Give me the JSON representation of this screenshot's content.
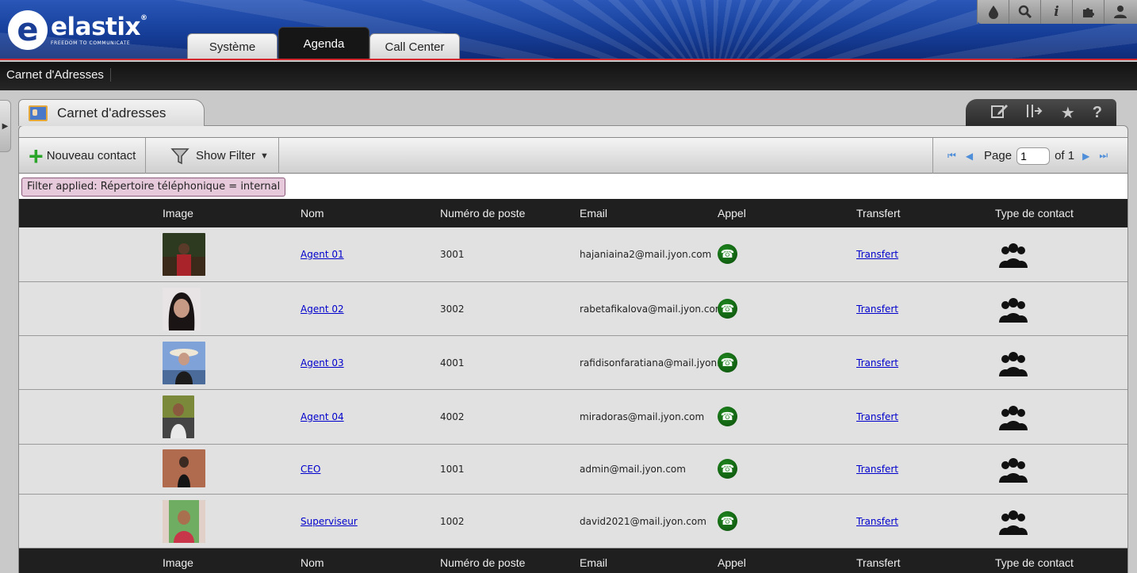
{
  "brand": {
    "logo_mark": "e",
    "name": "elastix",
    "reg": "®",
    "slogan": "FREEDOM TO COMMUNICATE"
  },
  "nav": {
    "tabs": [
      {
        "label": "Système",
        "active": false
      },
      {
        "label": "Agenda",
        "active": true
      },
      {
        "label": "Call Center",
        "active": false
      }
    ],
    "top_icons": [
      "theme-drop-icon",
      "search-icon",
      "info-icon",
      "puzzle-icon",
      "user-icon"
    ]
  },
  "submenu": {
    "items": [
      "Carnet d'Adresses"
    ]
  },
  "module": {
    "title": "Carnet d'adresses",
    "action_icons": [
      "edit-icon",
      "export-icon",
      "star-icon",
      "help-icon"
    ]
  },
  "toolbar": {
    "new_contact_label": "Nouveau contact",
    "show_filter_label": "Show Filter",
    "page_label": "Page",
    "page_value": "1",
    "of_label": "of 1"
  },
  "filter": {
    "applied_text": "Filter applied: Répertoire téléphonique = internal"
  },
  "table": {
    "columns": [
      "Image",
      "Nom",
      "Numéro de poste",
      "Email",
      "Appel",
      "Transfert",
      "Type de contact"
    ],
    "rows": [
      {
        "nom": "Agent 01",
        "numero": "3001",
        "email": "hajaniaina2@mail.jyon.com",
        "transfert": "Transfert"
      },
      {
        "nom": "Agent 02",
        "numero": "3002",
        "email": "rabetafikalova@mail.jyon.com",
        "transfert": "Transfert"
      },
      {
        "nom": "Agent 03",
        "numero": "4001",
        "email": "rafidisonfaratiana@mail.jyon.com",
        "transfert": "Transfert"
      },
      {
        "nom": "Agent 04",
        "numero": "4002",
        "email": "miradoras@mail.jyon.com",
        "transfert": "Transfert"
      },
      {
        "nom": "CEO",
        "numero": "1001",
        "email": "admin@mail.jyon.com",
        "transfert": "Transfert"
      },
      {
        "nom": "Superviseur",
        "numero": "1002",
        "email": "david2021@mail.jyon.com",
        "transfert": "Transfert"
      }
    ]
  },
  "colors": {
    "header_blue": "#163f9a",
    "accent_red": "#d2282e",
    "filter_chip": "#e6c9da",
    "call_green": "#0b4c0b",
    "link_blue": "#0000cc"
  }
}
